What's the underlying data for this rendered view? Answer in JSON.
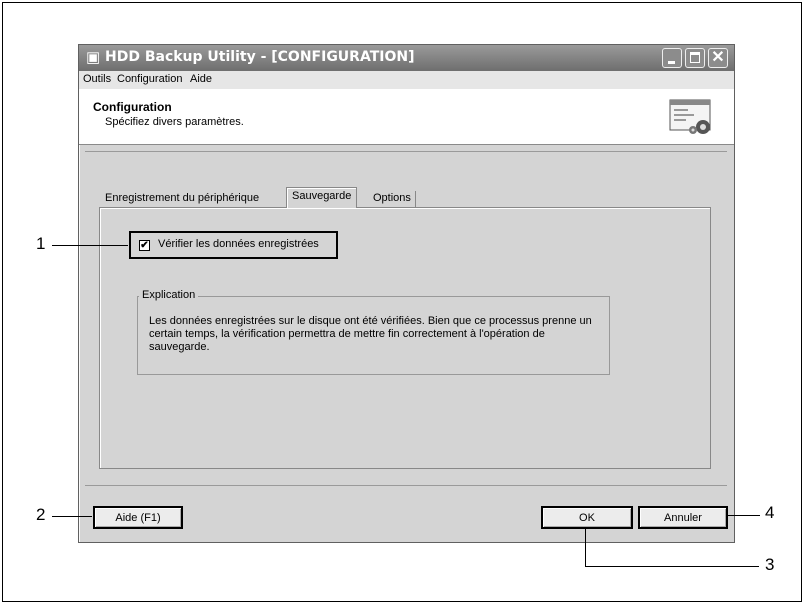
{
  "window": {
    "title": "HDD Backup Utility - [CONFIGURATION]",
    "app_icon": "disk-icon",
    "controls": [
      "minimize-icon",
      "maximize-icon",
      "close-icon"
    ]
  },
  "menu": {
    "items": [
      "Outils",
      "Configuration",
      "Aide"
    ]
  },
  "header": {
    "title": "Configuration",
    "subtitle": "Spécifiez divers paramètres.",
    "image": "settings-dialog-icon"
  },
  "tabs": [
    {
      "label": "Enregistrement du périphérique",
      "selected": false
    },
    {
      "label": "Sauvegarde",
      "selected": true
    },
    {
      "label": "Options",
      "selected": false
    }
  ],
  "verify_option": {
    "label": "Vérifier les données enregistrées",
    "checked": true,
    "check_mark": "✔"
  },
  "explanation": {
    "legend": "Explication",
    "text": "Les données enregistrées sur le disque ont été vérifiées. Bien que ce processus prenne un certain temps, la vérification permettra de mettre fin correctement à l'opération de sauvegarde."
  },
  "buttons": {
    "help": "Aide (F1)",
    "ok": "OK",
    "cancel": "Annuler"
  },
  "callouts": [
    "1",
    "2",
    "3",
    "4"
  ]
}
